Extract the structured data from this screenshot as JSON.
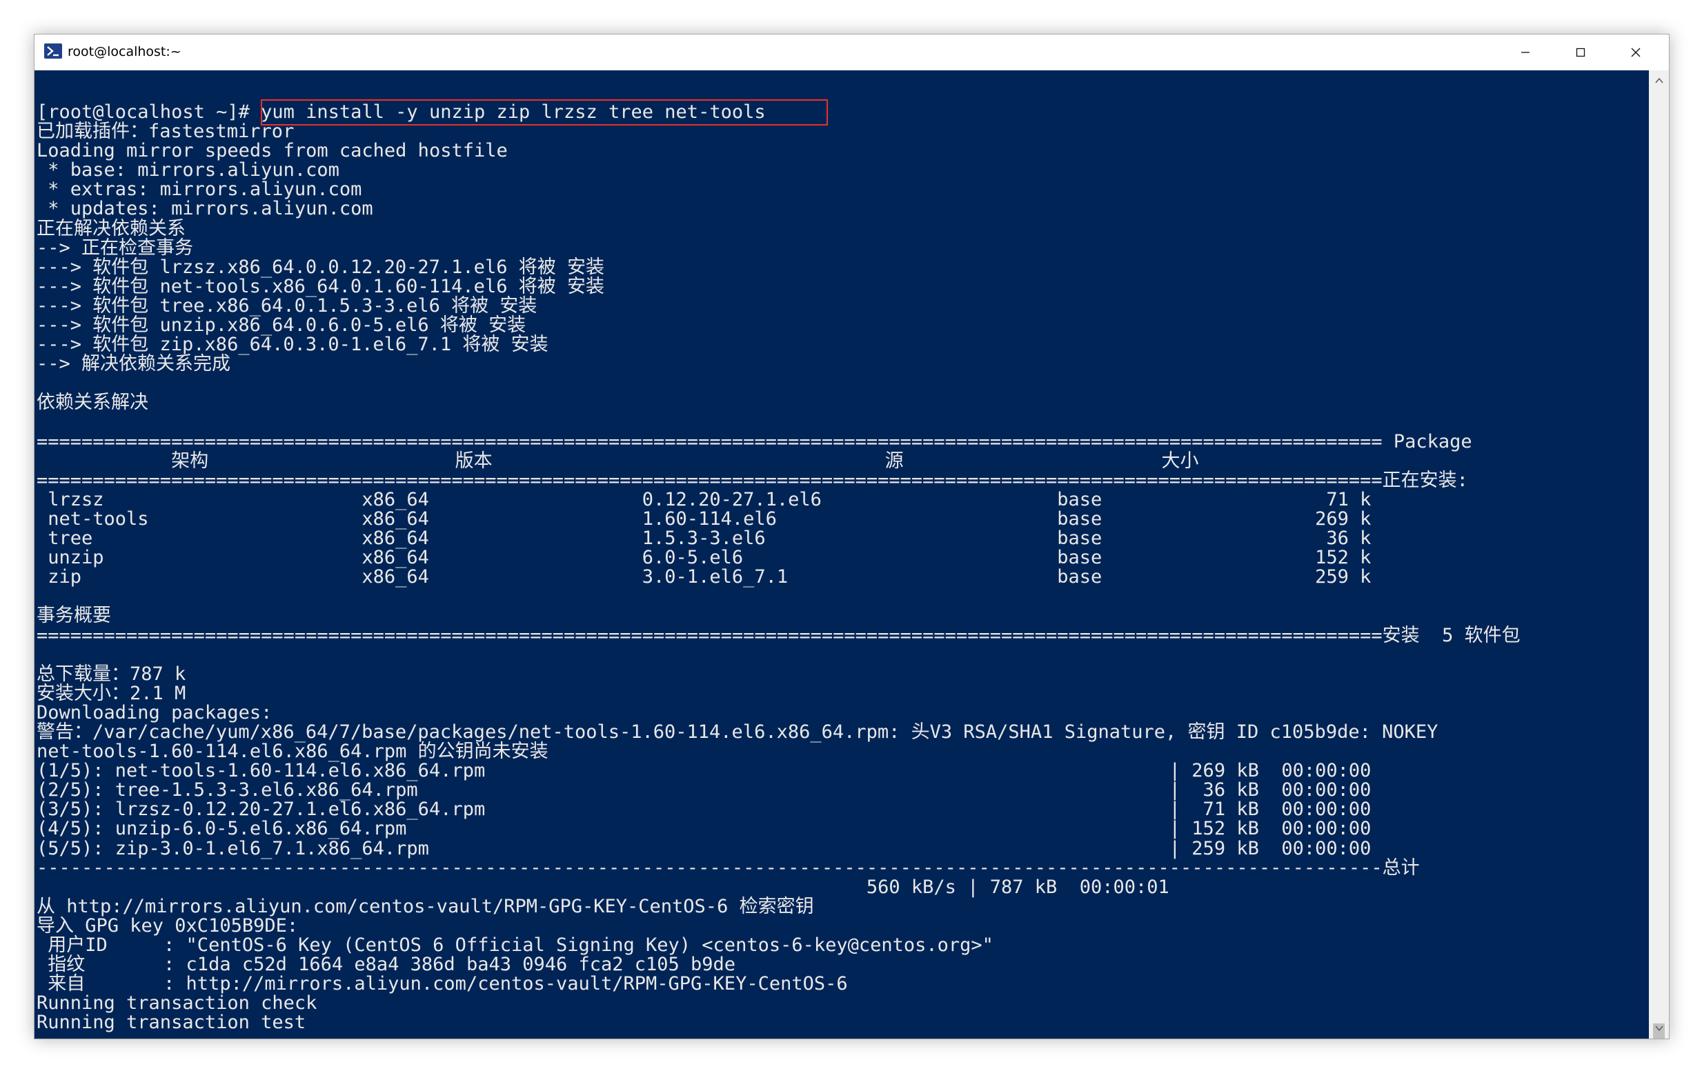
{
  "window": {
    "title": "root@localhost:~",
    "accent_color": "#012456",
    "icon": "powershell-terminal-icon"
  },
  "terminal": {
    "highlighted_command": "yum install -y unzip zip lrzsz tree net-tools",
    "lines": [
      "[root@localhost ~]# yum install -y unzip zip lrzsz tree net-tools",
      "已加载插件：fastestmirror",
      "Loading mirror speeds from cached hostfile",
      " * base: mirrors.aliyun.com",
      " * extras: mirrors.aliyun.com",
      " * updates: mirrors.aliyun.com",
      "正在解决依赖关系",
      "--> 正在检查事务",
      "---> 软件包 lrzsz.x86_64.0.0.12.20-27.1.el6 将被 安装",
      "---> 软件包 net-tools.x86_64.0.1.60-114.el6 将被 安装",
      "---> 软件包 tree.x86_64.0.1.5.3-3.el6 将被 安装",
      "---> 软件包 unzip.x86_64.0.6.0-5.el6 将被 安装",
      "---> 软件包 zip.x86_64.0.3.0-1.el6_7.1 将被 安装",
      "--> 解决依赖关系完成",
      "",
      "依赖关系解决",
      "",
      "======================================================================================================================== Package",
      "            架构                      版本                                   源                       大小",
      "========================================================================================================================正在安装:",
      " lrzsz                       x86_64                   0.12.20-27.1.el6                     base                    71 k",
      " net-tools                   x86_64                   1.60-114.el6                         base                   269 k",
      " tree                        x86_64                   1.5.3-3.el6                          base                    36 k",
      " unzip                       x86_64                   6.0-5.el6                            base                   152 k",
      " zip                         x86_64                   3.0-1.el6_7.1                        base                   259 k",
      "",
      "事务概要",
      "========================================================================================================================安装  5 软件包",
      "",
      "总下载量：787 k",
      "安装大小：2.1 M",
      "Downloading packages:",
      "警告：/var/cache/yum/x86_64/7/base/packages/net-tools-1.60-114.el6.x86_64.rpm: 头V3 RSA/SHA1 Signature, 密钥 ID c105b9de: NOKEY",
      "net-tools-1.60-114.el6.x86_64.rpm 的公钥尚未安装",
      "(1/5): net-tools-1.60-114.el6.x86_64.rpm                                                             | 269 kB  00:00:00",
      "(2/5): tree-1.5.3-3.el6.x86_64.rpm                                                                   |  36 kB  00:00:00",
      "(3/5): lrzsz-0.12.20-27.1.el6.x86_64.rpm                                                             |  71 kB  00:00:00",
      "(4/5): unzip-6.0-5.el6.x86_64.rpm                                                                    | 152 kB  00:00:00",
      "(5/5): zip-3.0-1.el6_7.1.x86_64.rpm                                                                  | 259 kB  00:00:00",
      "------------------------------------------------------------------------------------------------------------------------总计",
      "                                                                          560 kB/s | 787 kB  00:00:01",
      "从 http://mirrors.aliyun.com/centos-vault/RPM-GPG-KEY-CentOS-6 检索密钥",
      "导入 GPG key 0xC105B9DE:",
      " 用户ID     : \"CentOS-6 Key (CentOS 6 Official Signing Key) <centos-6-key@centos.org>\"",
      " 指纹       : c1da c52d 1664 e8a4 386d ba43 0946 fca2 c105 b9de",
      " 来自       : http://mirrors.aliyun.com/centos-vault/RPM-GPG-KEY-CentOS-6",
      "Running transaction check",
      "Running transaction test"
    ]
  }
}
